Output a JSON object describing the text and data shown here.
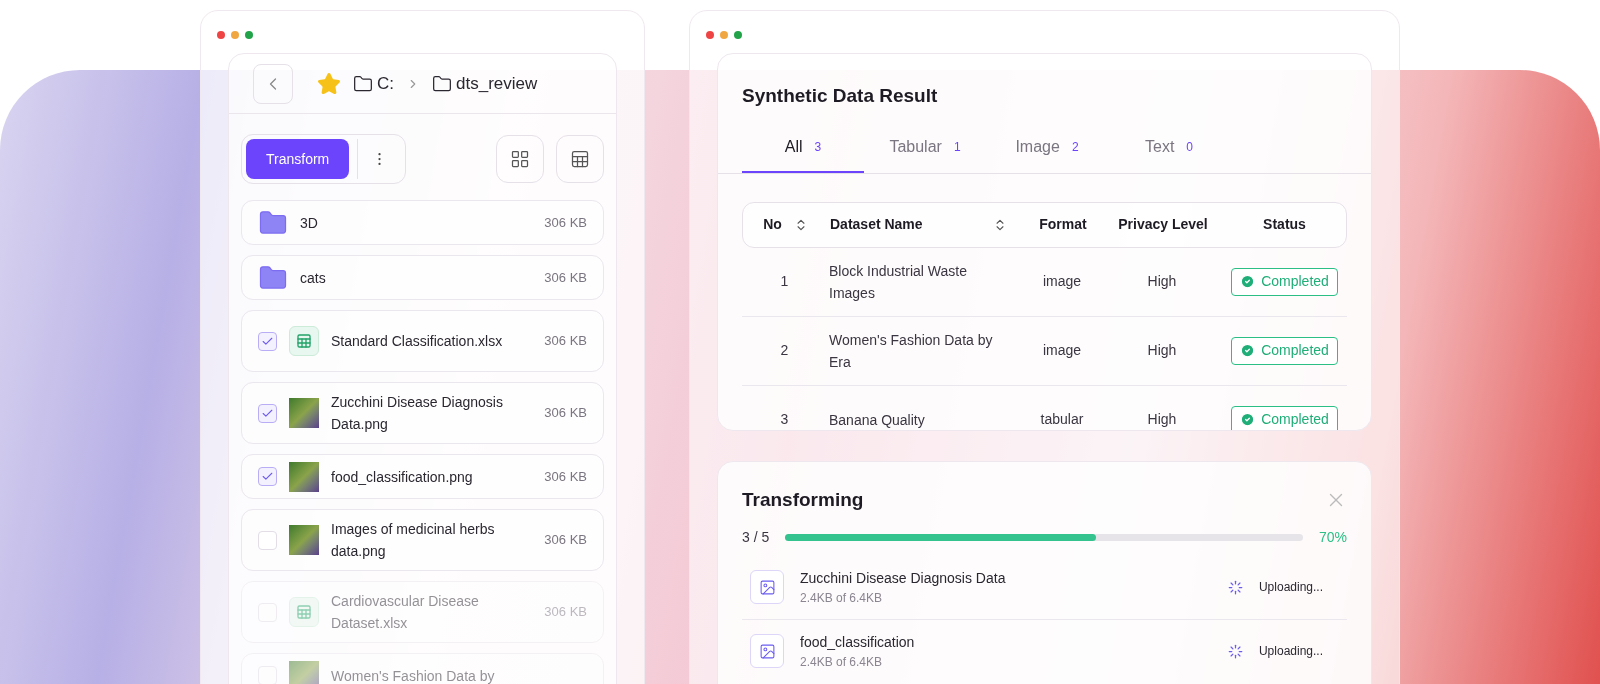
{
  "explorer": {
    "path": [
      "C:",
      "dts_review"
    ],
    "primary_button": "Transform",
    "files": [
      {
        "kind": "folder",
        "name": "3D",
        "size": "306 KB",
        "dimmed": false
      },
      {
        "kind": "folder",
        "name": "cats",
        "size": "306 KB",
        "dimmed": false
      },
      {
        "kind": "sheet",
        "name": "Standard Classification.xlsx",
        "size": "306 KB",
        "checked": true,
        "dimmed": false
      },
      {
        "kind": "image",
        "name": "Zucchini Disease Diagnosis Data.png",
        "size": "306 KB",
        "checked": true,
        "dimmed": false
      },
      {
        "kind": "image",
        "name": "food_classification.png",
        "size": "306 KB",
        "checked": true,
        "dimmed": false
      },
      {
        "kind": "image",
        "name": "Images of medicinal herbs data.png",
        "size": "306 KB",
        "checked": false,
        "dimmed": false
      },
      {
        "kind": "sheet",
        "name": "Cardiovascular Disease Dataset.xlsx",
        "size": "306 KB",
        "checked": false,
        "dimmed": true
      },
      {
        "kind": "image",
        "name": "Women's Fashion Data by",
        "checked": false,
        "dimmed": true
      }
    ]
  },
  "results": {
    "title": "Synthetic Data Result",
    "tabs": [
      {
        "label": "All",
        "count": "3",
        "selected": true
      },
      {
        "label": "Tabular",
        "count": "1",
        "selected": false
      },
      {
        "label": "Image",
        "count": "2",
        "selected": false
      },
      {
        "label": "Text",
        "count": "0",
        "selected": false
      }
    ],
    "columns": [
      {
        "label": "No",
        "sortable": true
      },
      {
        "label": "Dataset Name",
        "sortable": true
      },
      {
        "label": "Format",
        "sortable": false
      },
      {
        "label": "Privacy Level",
        "sortable": false
      },
      {
        "label": "Status",
        "sortable": false
      }
    ],
    "rows": [
      {
        "no": "1",
        "name": "Block Industrial Waste Images",
        "format": "image",
        "privacy": "High",
        "status": "Completed"
      },
      {
        "no": "2",
        "name": "Women's Fashion Data by Era",
        "format": "image",
        "privacy": "High",
        "status": "Completed"
      },
      {
        "no": "3",
        "name": "Banana Quality",
        "format": "tabular",
        "privacy": "High",
        "status": "Completed"
      }
    ]
  },
  "transforming": {
    "title": "Transforming",
    "count": "3 / 5",
    "level": 0.6,
    "reading": "70%",
    "uploads": [
      {
        "name": "Zucchini Disease Diagnosis Data",
        "size": "2.4KB of 6.4KB",
        "status": "Uploading..."
      },
      {
        "name": "food_classification",
        "size": "2.4KB of 6.4KB",
        "status": "Uploading..."
      }
    ]
  }
}
